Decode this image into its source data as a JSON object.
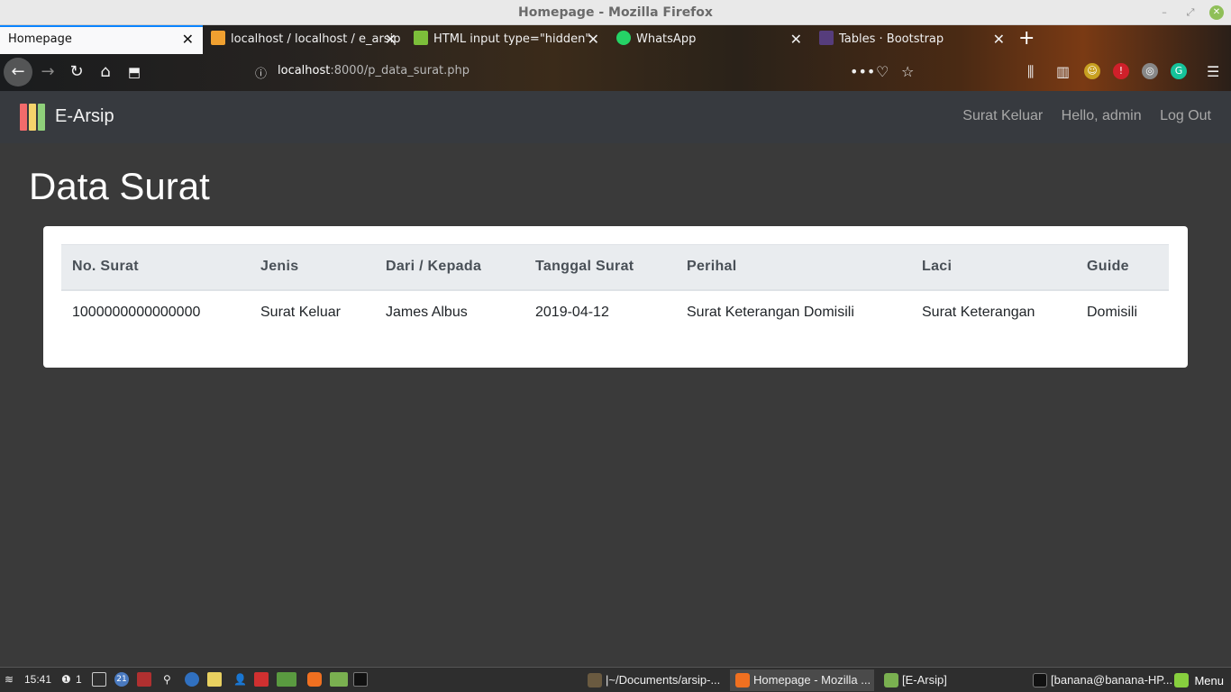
{
  "window": {
    "title": "Homepage - Mozilla Firefox"
  },
  "browser": {
    "tabs": [
      {
        "label": "Homepage",
        "active": true
      },
      {
        "label": "localhost / localhost / e_arsip",
        "active": false
      },
      {
        "label": "HTML input type=\"hidden\"",
        "active": false
      },
      {
        "label": "WhatsApp",
        "active": false
      },
      {
        "label": "Tables · Bootstrap",
        "active": false
      }
    ],
    "url_host": "localhost",
    "url_rest": ":8000/p_data_surat.php"
  },
  "app": {
    "brand": "E-Arsip",
    "nav": {
      "link1": "Surat Keluar",
      "link2": "Hello, admin",
      "link3": "Log Out"
    },
    "title": "Data Surat",
    "table": {
      "headers": [
        "No. Surat",
        "Jenis",
        "Dari / Kepada",
        "Tanggal Surat",
        "Perihal",
        "Laci",
        "Guide"
      ],
      "rows": [
        [
          "1000000000000000",
          "Surat Keluar",
          "James Albus",
          "2019-04-12",
          "Surat Keterangan Domisili",
          "Surat Keterangan",
          "Domisili"
        ]
      ]
    }
  },
  "taskbar": {
    "clock": "15:41",
    "alert_count": "1",
    "badge_count": "21",
    "tasks": [
      {
        "label": "|~/Documents/arsip-..."
      },
      {
        "label": "Homepage - Mozilla ..."
      },
      {
        "label": "[E-Arsip]"
      },
      {
        "label": "[banana@banana-HP..."
      }
    ],
    "menu_label": "Menu"
  }
}
